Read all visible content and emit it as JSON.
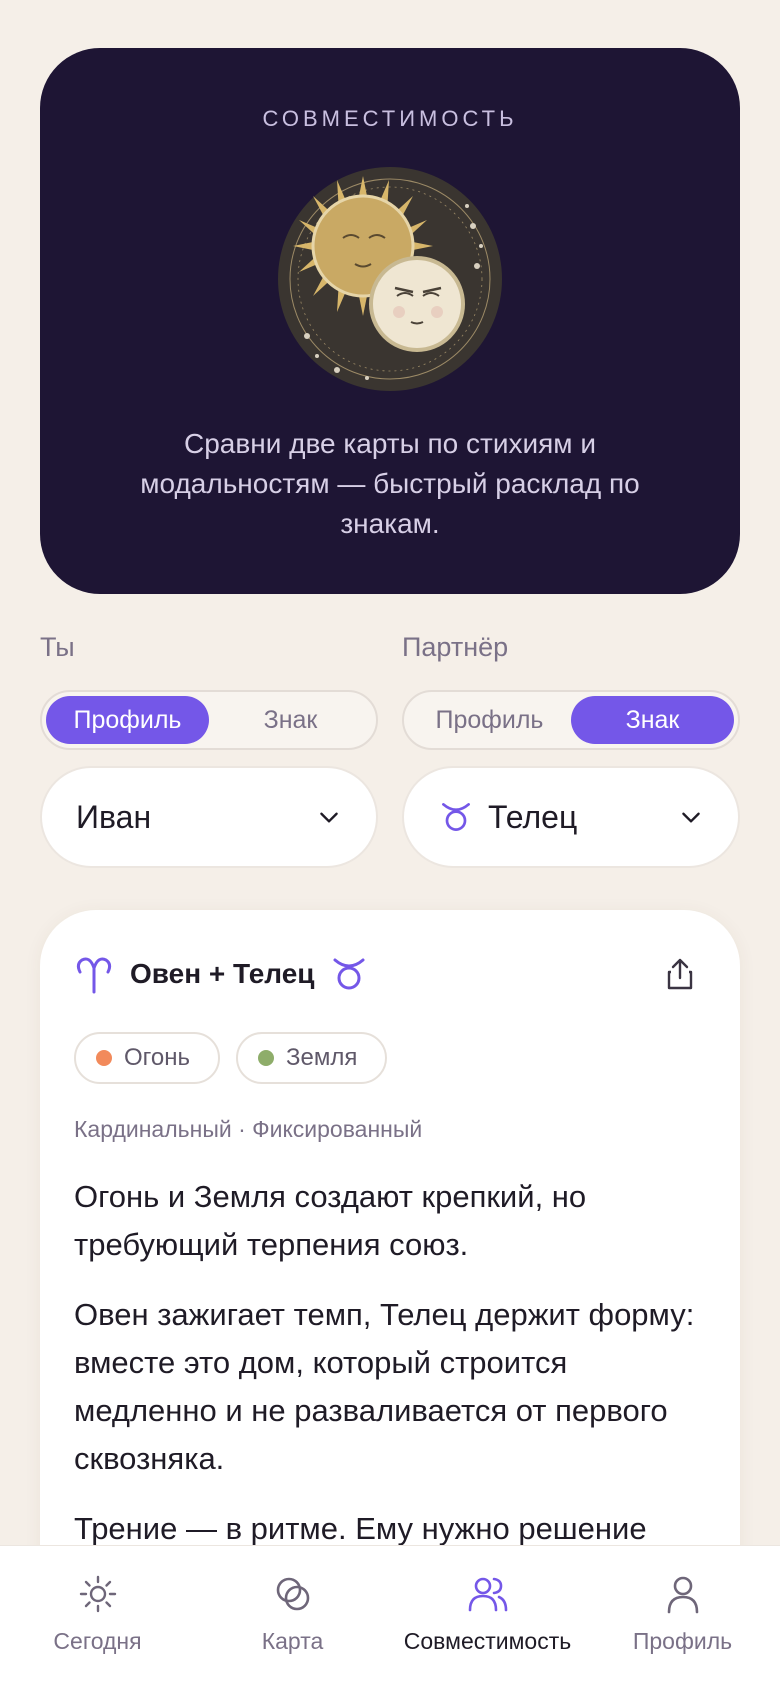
{
  "hero": {
    "eyebrow": "СОВМЕСТИМОСТЬ",
    "description": "Сравни две карты по стихиям и модальностям — быстрый расклад по знакам."
  },
  "you": {
    "label": "Ты",
    "toggle": {
      "options": [
        "Профиль",
        "Знак"
      ],
      "selected": "Профиль"
    },
    "select_value": "Иван"
  },
  "partner": {
    "label": "Партнёр",
    "toggle": {
      "options": [
        "Профиль",
        "Знак"
      ],
      "selected": "Знак"
    },
    "select_value": "Телец",
    "select_icon": "taurus-icon"
  },
  "result": {
    "title": "Овен + Телец",
    "sign_left_icon": "aries-icon",
    "sign_right_icon": "taurus-icon",
    "chips": [
      {
        "label": "Огонь",
        "color": "#f28a5b"
      },
      {
        "label": "Земля",
        "color": "#8ead6a"
      }
    ],
    "modality": "Кардинальный · Фиксированный",
    "paragraphs": [
      "Огонь и Земля создают крепкий, но требующий терпения союз.",
      "Овен зажигает темп, Телец держит форму: вместе это дом, который строится медленно и не разваливается от первого сквозняка.",
      "Трение — в ритме. Ему нужно решение"
    ]
  },
  "colors": {
    "accent": "#7457e8",
    "hero_bg": "#1e1534",
    "page_bg": "#f5efe8"
  },
  "tabbar": {
    "tabs": [
      {
        "label": "Сегодня",
        "icon": "sun-icon",
        "active": false
      },
      {
        "label": "Карта",
        "icon": "rings-icon",
        "active": false
      },
      {
        "label": "Совместимость",
        "icon": "people-icon",
        "active": true
      },
      {
        "label": "Профиль",
        "icon": "person-icon",
        "active": false
      }
    ]
  }
}
